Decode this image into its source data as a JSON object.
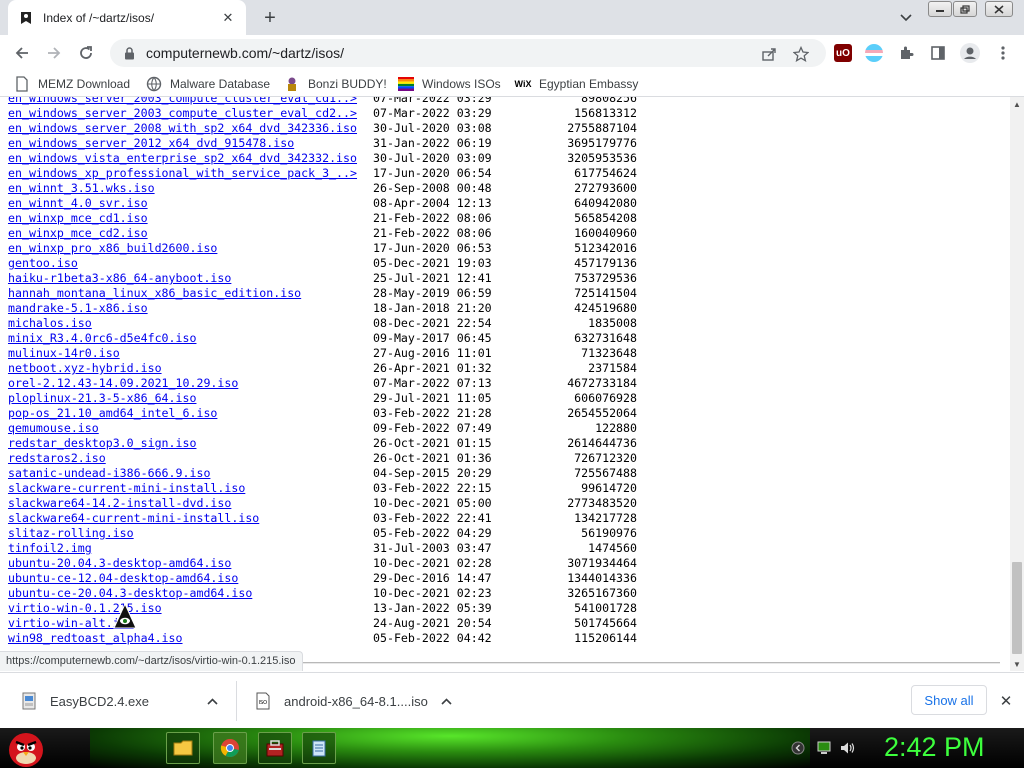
{
  "browser": {
    "tab_title": "Index of /~dartz/isos/",
    "url": "computernewb.com/~dartz/isos/",
    "status_url": "https://computernewb.com/~dartz/isos/virtio-win-0.1.215.iso"
  },
  "bookmarks": [
    {
      "label": "MEMZ Download",
      "icon": "document-icon"
    },
    {
      "label": "Malware Database",
      "icon": "globe-icon"
    },
    {
      "label": "Bonzi BUDDY!",
      "icon": "bonzi-icon"
    },
    {
      "label": "Windows ISOs",
      "icon": "windows-flag-icon"
    },
    {
      "label": "Egyptian Embassy",
      "icon": "wix-icon"
    }
  ],
  "partial_row": {
    "name": "en_windows_server_2003_compute_cluster_eval_cd1..>",
    "date": "07-Mar-2022 03:29",
    "size": "89808256"
  },
  "files": [
    {
      "name": "en_windows_server_2003_compute_cluster_eval_cd2..>",
      "date": "07-Mar-2022 03:29",
      "size": "156813312"
    },
    {
      "name": "en_windows_server_2008_with_sp2_x64_dvd_342336.iso",
      "date": "30-Jul-2020 03:08",
      "size": "2755887104"
    },
    {
      "name": "en_windows_server_2012_x64_dvd_915478.iso",
      "date": "31-Jan-2022 06:19",
      "size": "3695179776"
    },
    {
      "name": "en_windows_vista_enterprise_sp2_x64_dvd_342332.iso",
      "date": "30-Jul-2020 03:09",
      "size": "3205953536"
    },
    {
      "name": "en_windows_xp_professional_with_service_pack_3_..>",
      "date": "17-Jun-2020 06:54",
      "size": "617754624"
    },
    {
      "name": "en_winnt_3.51.wks.iso",
      "date": "26-Sep-2008 00:48",
      "size": "272793600"
    },
    {
      "name": "en_winnt_4.0_svr.iso",
      "date": "08-Apr-2004 12:13",
      "size": "640942080"
    },
    {
      "name": "en_winxp_mce_cd1.iso",
      "date": "21-Feb-2022 08:06",
      "size": "565854208"
    },
    {
      "name": "en_winxp_mce_cd2.iso",
      "date": "21-Feb-2022 08:06",
      "size": "160040960"
    },
    {
      "name": "en_winxp_pro_x86_build2600.iso",
      "date": "17-Jun-2020 06:53",
      "size": "512342016"
    },
    {
      "name": "gentoo.iso",
      "date": "05-Dec-2021 19:03",
      "size": "457179136"
    },
    {
      "name": "haiku-r1beta3-x86_64-anyboot.iso",
      "date": "25-Jul-2021 12:41",
      "size": "753729536"
    },
    {
      "name": "hannah_montana_linux_x86_basic_edition.iso",
      "date": "28-May-2019 06:59",
      "size": "725141504"
    },
    {
      "name": "mandrake-5.1-x86.iso",
      "date": "18-Jan-2018 21:20",
      "size": "424519680"
    },
    {
      "name": "michalos.iso",
      "date": "08-Dec-2021 22:54",
      "size": "1835008"
    },
    {
      "name": "minix_R3.4.0rc6-d5e4fc0.iso",
      "date": "09-May-2017 06:45",
      "size": "632731648"
    },
    {
      "name": "mulinux-14r0.iso",
      "date": "27-Aug-2016 11:01",
      "size": "71323648"
    },
    {
      "name": "netboot.xyz-hybrid.iso",
      "date": "26-Apr-2021 01:32",
      "size": "2371584"
    },
    {
      "name": "orel-2.12.43-14.09.2021_10.29.iso",
      "date": "07-Mar-2022 07:13",
      "size": "4672733184"
    },
    {
      "name": "ploplinux-21.3-5-x86_64.iso",
      "date": "29-Jul-2021 11:05",
      "size": "606076928"
    },
    {
      "name": "pop-os_21.10_amd64_intel_6.iso",
      "date": "03-Feb-2022 21:28",
      "size": "2654552064"
    },
    {
      "name": "qemumouse.iso",
      "date": "09-Feb-2022 07:49",
      "size": "122880"
    },
    {
      "name": "redstar_desktop3.0_sign.iso",
      "date": "26-Oct-2021 01:15",
      "size": "2614644736"
    },
    {
      "name": "redstaros2.iso",
      "date": "26-Oct-2021 01:36",
      "size": "726712320"
    },
    {
      "name": "satanic-undead-i386-666.9.iso",
      "date": "04-Sep-2015 20:29",
      "size": "725567488"
    },
    {
      "name": "slackware-current-mini-install.iso",
      "date": "03-Feb-2022 22:15",
      "size": "99614720"
    },
    {
      "name": "slackware64-14.2-install-dvd.iso",
      "date": "10-Dec-2021 05:00",
      "size": "2773483520"
    },
    {
      "name": "slackware64-current-mini-install.iso",
      "date": "03-Feb-2022 22:41",
      "size": "134217728"
    },
    {
      "name": "slitaz-rolling.iso",
      "date": "05-Feb-2022 04:29",
      "size": "56190976"
    },
    {
      "name": "tinfoil2.img",
      "date": "31-Jul-2003 03:47",
      "size": "1474560"
    },
    {
      "name": "ubuntu-20.04.3-desktop-amd64.iso",
      "date": "10-Dec-2021 02:28",
      "size": "3071934464"
    },
    {
      "name": "ubuntu-ce-12.04-desktop-amd64.iso",
      "date": "29-Dec-2016 14:47",
      "size": "1344014336"
    },
    {
      "name": "ubuntu-ce-20.04.3-desktop-amd64.iso",
      "date": "10-Dec-2021 02:23",
      "size": "3265167360"
    },
    {
      "name": "virtio-win-0.1.215.iso",
      "date": "13-Jan-2022 05:39",
      "size": "541001728"
    },
    {
      "name": "virtio-win-alt.iso",
      "date": "24-Aug-2021 20:54",
      "size": "501745664"
    },
    {
      "name": "win98_redtoast_alpha4.iso",
      "date": "05-Feb-2022 04:42",
      "size": "115206144"
    }
  ],
  "downloads": {
    "items": [
      {
        "name": "EasyBCD2.4.exe",
        "icon": "installer-icon"
      },
      {
        "name": "android-x86_64-8.1....iso",
        "icon": "iso-file-icon"
      }
    ],
    "show_all": "Show all"
  },
  "taskbar": {
    "clock": "2:42 PM",
    "pinned": [
      "folder-icon",
      "chrome-icon",
      "toolbox-icon",
      "notepad-icon"
    ]
  },
  "colors": {
    "link": "#0000ee",
    "tabstrip": "#dee1e6",
    "clock": "#3dff3d",
    "accent": "#1a73e8"
  }
}
